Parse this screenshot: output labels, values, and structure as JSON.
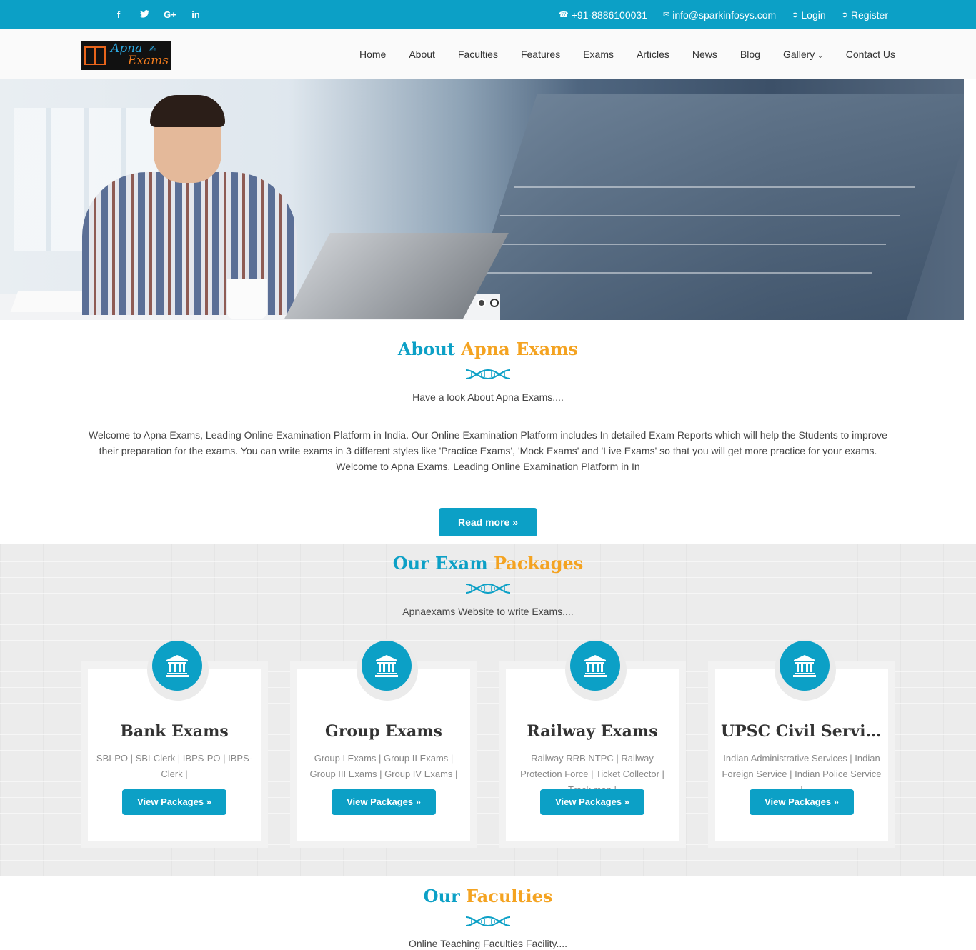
{
  "topbar": {
    "social": [
      {
        "icon": "facebook-icon",
        "glyph": "f"
      },
      {
        "icon": "twitter-icon",
        "glyph": "t"
      },
      {
        "icon": "google-plus-icon",
        "glyph": "G+"
      },
      {
        "icon": "linkedin-icon",
        "glyph": "in"
      }
    ],
    "phone": "+91-8886100031",
    "email": "info@sparkinfosys.com",
    "login": "Login",
    "register": "Register"
  },
  "brand": {
    "line1": "Apna",
    "line2": "Exams"
  },
  "nav": {
    "items": [
      "Home",
      "About",
      "Faculties",
      "Features",
      "Exams",
      "Articles",
      "News",
      "Blog",
      "Gallery",
      "Contact Us"
    ]
  },
  "about": {
    "title_part1": "About",
    "title_part2": "Apna Exams",
    "subtitle": "Have a look About Apna Exams....",
    "body": "Welcome to Apna Exams, Leading Online Examination Platform in India. Our Online Examination Platform includes In detailed Exam Reports which will help the Students to improve their preparation for the exams. You can write exams in 3 different styles like 'Practice Exams', 'Mock Exams' and 'Live Exams' so that you will get more practice for your exams. Welcome to Apna Exams, Leading Online Examination Platform in In",
    "read_more": "Read more »"
  },
  "packages": {
    "title_part1": "Our Exam",
    "title_part2": "Packages",
    "subtitle": "Apnaexams Website to write Exams....",
    "button_label": "View Packages »",
    "cards": [
      {
        "name": "Bank Exams",
        "list": "SBI-PO | SBI-Clerk | IBPS-PO | IBPS-Clerk |"
      },
      {
        "name": "Group Exams",
        "list": "Group I Exams | Group II Exams | Group III Exams | Group IV Exams |"
      },
      {
        "name": "Railway Exams",
        "list": "Railway RRB NTPC | Railway Protection Force | Ticket Collector | Track man |"
      },
      {
        "name": "UPSC Civil Servic...",
        "list": "Indian Administrative Services | Indian Foreign Service | Indian Police Service |"
      }
    ]
  },
  "faculties": {
    "title_part1": "Our",
    "title_part2": "Faculties",
    "subtitle": "Online Teaching Faculties Facility...."
  },
  "colors": {
    "accent": "#0ca0c6",
    "highlight": "#f4a321"
  }
}
